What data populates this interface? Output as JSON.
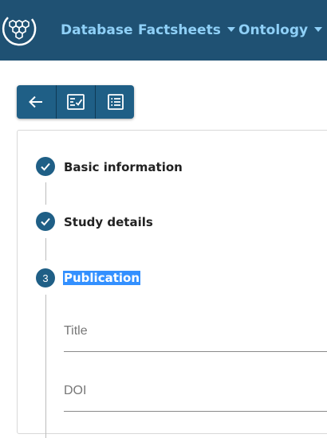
{
  "navbar": {
    "logo_icon": "hexagon-honeycomb-logo",
    "items": [
      {
        "label": "Database",
        "dropdown": false
      },
      {
        "label": "Factsheets",
        "dropdown": true
      },
      {
        "label": "Ontology",
        "dropdown": true
      }
    ]
  },
  "toolbar": {
    "buttons": [
      {
        "icon": "arrow-left-icon"
      },
      {
        "icon": "checklist-icon"
      },
      {
        "icon": "list-icon"
      }
    ]
  },
  "stepper": {
    "steps": [
      {
        "label": "Basic information",
        "status": "completed",
        "icon": "check-icon"
      },
      {
        "label": "Study details",
        "status": "completed",
        "icon": "check-icon"
      },
      {
        "label": "Publication",
        "status": "active",
        "number": "3"
      }
    ]
  },
  "form": {
    "fields": [
      {
        "label": "Title",
        "value": ""
      },
      {
        "label": "DOI",
        "value": ""
      }
    ]
  },
  "colors": {
    "navbar_bg": "#1f5173",
    "nav_link": "#8fd0f7",
    "accent": "#1f5f86",
    "selection": "#3390ff"
  }
}
